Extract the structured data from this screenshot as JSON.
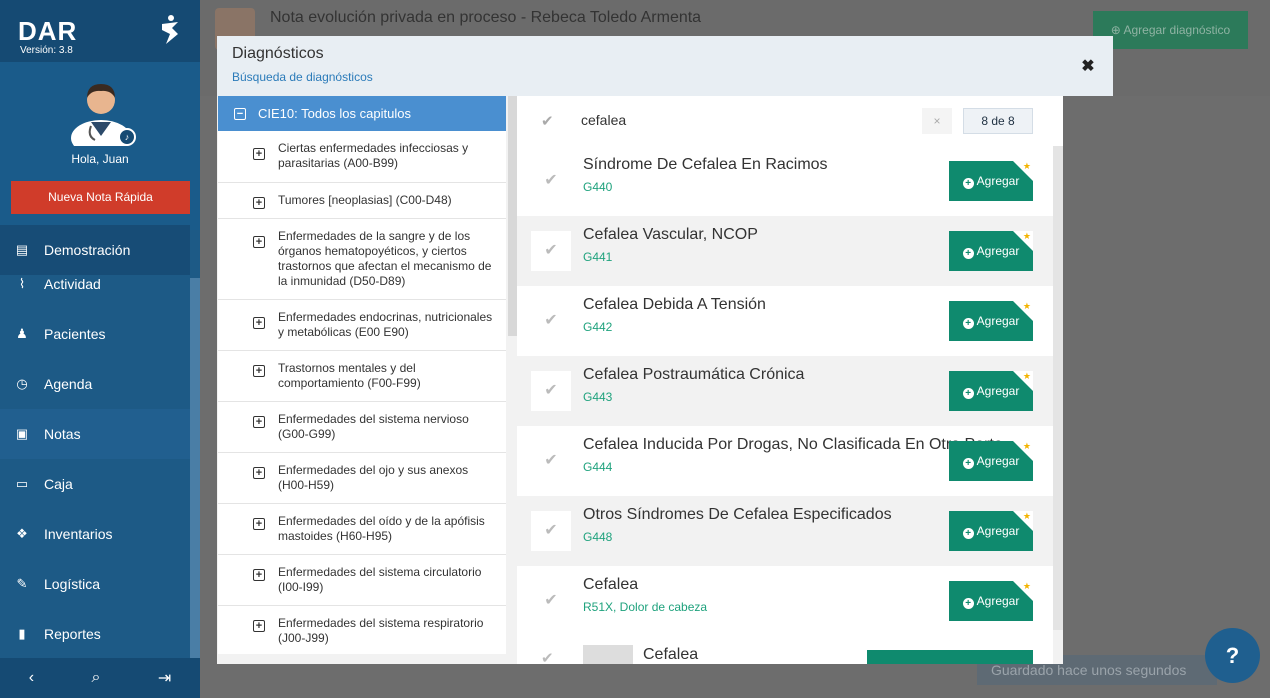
{
  "app": {
    "name": "DAR",
    "version": "Versión: 3.8"
  },
  "profile": {
    "greeting": "Hola, Juan"
  },
  "quick_note_label": "Nueva Nota Rápida",
  "nav": [
    {
      "label": "Demostración",
      "icon": "clipboard-icon"
    },
    {
      "label": "Actividad",
      "icon": "pulse-icon"
    },
    {
      "label": "Pacientes",
      "icon": "user-icon"
    },
    {
      "label": "Agenda",
      "icon": "clock-icon"
    },
    {
      "label": "Notas",
      "icon": "note-icon"
    },
    {
      "label": "Caja",
      "icon": "cash-icon"
    },
    {
      "label": "Inventarios",
      "icon": "dropbox-icon"
    },
    {
      "label": "Logística",
      "icon": "wand-icon"
    },
    {
      "label": "Reportes",
      "icon": "file-icon"
    }
  ],
  "header": {
    "title": "Nota evolución privada en proceso - Rebeca Toledo Armenta",
    "add_diagnosis_label": "Agregar diagnóstico"
  },
  "modal": {
    "title": "Diagnósticos",
    "subtitle": "Búsqueda de diagnósticos",
    "close_symbol": "✖"
  },
  "tree": {
    "root_label": "CIE10: Todos los capitulos",
    "items": [
      "Ciertas enfermedades infecciosas y parasitarias (A00-B99)",
      "Tumores [neoplasias] (C00-D48)",
      "Enfermedades de la sangre y de los órganos hematopoyéticos, y ciertos trastornos que afectan el mecanismo de la inmunidad (D50-D89)",
      "Enfermedades endocrinas, nutricionales y metabólicas (E00 E90)",
      "Trastornos mentales y del comportamiento (F00-F99)",
      "Enfermedades del sistema nervioso (G00-G99)",
      "Enfermedades del ojo y sus anexos (H00-H59)",
      "Enfermedades del oído y de la apófisis mastoides (H60-H95)",
      "Enfermedades del sistema circulatorio (I00-I99)",
      "Enfermedades del sistema respiratorio (J00-J99)"
    ]
  },
  "search": {
    "query": "cefalea",
    "count": "8 de 8",
    "clear_symbol": "×"
  },
  "results": [
    {
      "title": "Síndrome De Cefalea En Racimos",
      "code": "G440"
    },
    {
      "title": "Cefalea Vascular, NCOP",
      "code": "G441"
    },
    {
      "title": "Cefalea Debida A Tensión",
      "code": "G442"
    },
    {
      "title": "Cefalea Postraumática Crónica",
      "code": "G443"
    },
    {
      "title": "Cefalea Inducida Por Drogas, No Clasificada En Otra Parte",
      "code": "G444"
    },
    {
      "title": "Otros Síndromes De Cefalea Especificados",
      "code": "G448"
    },
    {
      "title": "Cefalea",
      "code": "R51X, Dolor de cabeza"
    }
  ],
  "add_label": "Agregar",
  "partial_result_title": "Cefalea",
  "status_text": "Guardado hace unos segundos",
  "help_label": "?",
  "colors": {
    "sidebar": "#1d5a86",
    "accent": "#0f8a6e",
    "alert": "#d03c2a",
    "tree_head": "#4a8fd0"
  }
}
